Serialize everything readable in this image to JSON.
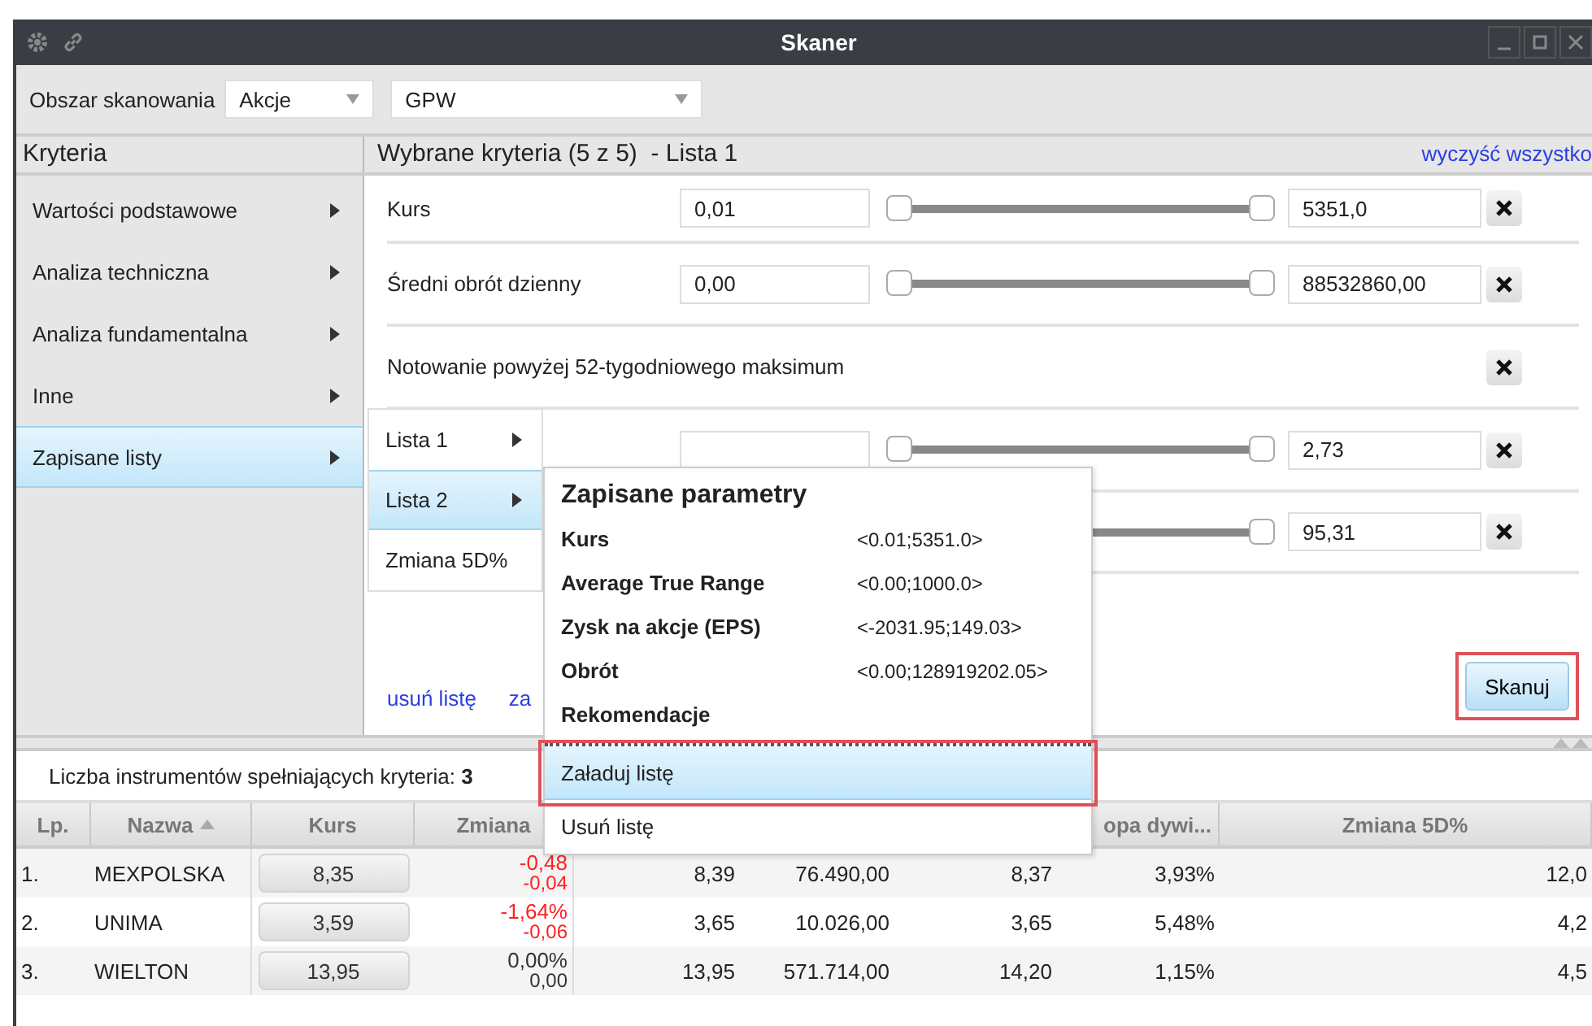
{
  "window": {
    "title": "Skaner"
  },
  "toolbar": {
    "label": "Obszar skanowania",
    "selects": [
      {
        "value": "Akcje"
      },
      {
        "value": "GPW"
      }
    ]
  },
  "left_panel": {
    "title": "Kryteria",
    "items": [
      {
        "label": "Wartości podstawowe",
        "selected": false
      },
      {
        "label": "Analiza techniczna",
        "selected": false
      },
      {
        "label": "Analiza fundamentalna",
        "selected": false
      },
      {
        "label": "Inne",
        "selected": false
      },
      {
        "label": "Zapisane listy",
        "selected": true
      }
    ]
  },
  "criteria": {
    "title": "Wybrane kryteria (5 z 5)  - Lista 1",
    "clear_link": "wyczyść wszystko",
    "rows": [
      {
        "kind": "range",
        "label": "Kurs",
        "min": "0,01",
        "max": "5351,0",
        "level": 1
      },
      {
        "kind": "range",
        "label": "Średni obrót dzienny",
        "min": "0,00",
        "max": "88532860,00",
        "level": 1
      },
      {
        "kind": "flag",
        "label": "Notowanie powyżej 52-tygodniowego maksimum"
      },
      {
        "kind": "range",
        "max": "2,73",
        "level": 1
      },
      {
        "kind": "range",
        "max": "95,31",
        "level": 1
      }
    ],
    "links": [
      "usuń listę",
      "za"
    ],
    "scan_button": {
      "label": "Skanuj",
      "highlighted": true
    }
  },
  "submenu": {
    "items": [
      {
        "label": "Lista 1",
        "has_children": true,
        "selected": false
      },
      {
        "label": "Lista 2",
        "has_children": true,
        "selected": true
      },
      {
        "label": "Zmiana 5D%",
        "has_children": false,
        "selected": false
      }
    ]
  },
  "saved_params_popup": {
    "title": "Zapisane parametry",
    "params": [
      {
        "name": "Kurs",
        "value": "<0.01;5351.0>"
      },
      {
        "name": "Average True Range",
        "value": "<0.00;1000.0>"
      },
      {
        "name": "Zysk na akcje (EPS)",
        "value": "<-2031.95;149.03>"
      },
      {
        "name": "Obrót",
        "value": "<0.00;128919202.05>"
      },
      {
        "name": "Rekomendacje"
      }
    ],
    "actions": [
      {
        "label": "Załaduj listę",
        "selected": true,
        "highlighted": true
      },
      {
        "label": "Usuń listę",
        "selected": false,
        "highlighted": false
      }
    ]
  },
  "results": {
    "count_text": "Liczba instrumentów spełniających kryteria: **3**",
    "columns": [
      {
        "label": "Lp."
      },
      {
        "label": "Nazwa",
        "sorted_ascending": true
      },
      {
        "label": "Kurs"
      },
      {
        "label": "Zmiana"
      },
      {},
      {},
      {},
      {
        "label": "opa dywi..."
      },
      {
        "label": "Zmiana 5D%"
      }
    ],
    "rows": [
      {
        "lp": "1.",
        "name": "MEXPOLSKA",
        "price": "8,35",
        "change_pct": "-0,48",
        "change_abs": "-0,04",
        "negative": true,
        "cells": [
          "8,39",
          "76.490,00",
          "8,37",
          "3,93%",
          "12,0"
        ]
      },
      {
        "lp": "2.",
        "name": "UNIMA",
        "price": "3,59",
        "change_pct": "-1,64%",
        "change_abs": "-0,06",
        "negative": true,
        "cells": [
          "3,65",
          "10.026,00",
          "3,65",
          "5,48%",
          "4,2"
        ]
      },
      {
        "lp": "3.",
        "name": "WIELTON",
        "price": "13,95",
        "change_pct": "0,00%",
        "change_abs": "0,00",
        "negative": false,
        "cells": [
          "13,95",
          "571.714,00",
          "14,20",
          "1,15%",
          "4,5"
        ]
      }
    ]
  }
}
